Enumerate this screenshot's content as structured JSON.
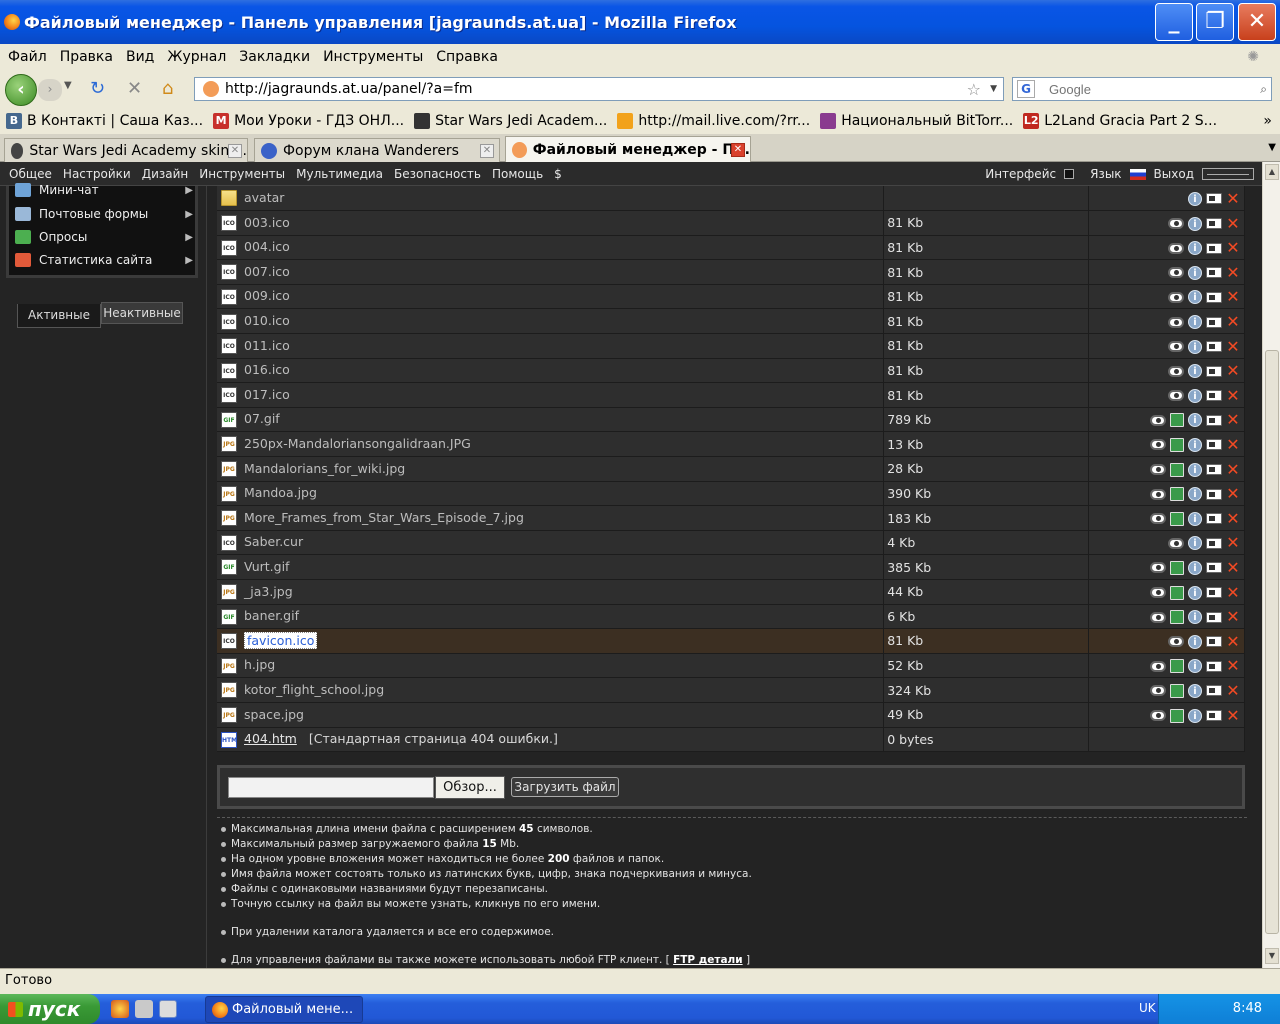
{
  "window": {
    "title": "Файловый менеджер - Панель управления [jagraunds.at.ua] - Mozilla Firefox",
    "min": "_",
    "max": "❐",
    "close": "✕"
  },
  "menu": [
    "Файл",
    "Правка",
    "Вид",
    "Журнал",
    "Закладки",
    "Инструменты",
    "Справка"
  ],
  "nav": {
    "url": "http://jagraunds.at.ua/panel/?a=fm",
    "search_placeholder": "Google"
  },
  "bookmarks": [
    {
      "label": "В Контакті | Саша Каз...",
      "icon": "В",
      "color": "#45688e"
    },
    {
      "label": "Мои Уроки - ГДЗ ОНЛ...",
      "icon": "M",
      "color": "#c7302b"
    },
    {
      "label": "Star Wars Jedi Academ...",
      "icon": "",
      "color": "#333333"
    },
    {
      "label": "http://mail.live.com/?rr...",
      "icon": "",
      "color": "#f2a21b"
    },
    {
      "label": "Национальный BitTorr...",
      "icon": "",
      "color": "#8a3b8f"
    },
    {
      "label": "L2Land Gracia Part 2 S...",
      "icon": "L2",
      "color": "#c0281f"
    }
  ],
  "tabs": [
    {
      "label": "Star Wars Jedi Academy skin ...",
      "color": "#444444"
    },
    {
      "label": "Форум клана Wanderers",
      "color": "#3a62c8"
    },
    {
      "label": "Файловый менеджер - П...",
      "color": "#f39c58"
    }
  ],
  "panel_menu": {
    "items": [
      "Общее",
      "Настройки",
      "Дизайн",
      "Инструменты",
      "Мультимедиа",
      "Безопасность",
      "Помощь",
      "$"
    ],
    "interface": "Интерфейс",
    "language": "Язык",
    "logout": "Выход"
  },
  "sidebar": {
    "items": [
      {
        "label": "Мини-чат",
        "color": "#6fa4d8"
      },
      {
        "label": "Почтовые формы",
        "color": "#9ab8d8"
      },
      {
        "label": "Опросы",
        "color": "#4caf50"
      },
      {
        "label": "Статистика сайта",
        "color": "#e25a3a"
      }
    ],
    "tab_active": "Активные",
    "tab_inactive": "Неактивные"
  },
  "files": [
    {
      "name": "avatar",
      "type": "folder",
      "size": "",
      "actions": [
        "info",
        "rename",
        "delete"
      ]
    },
    {
      "name": "003.ico",
      "type": "ico",
      "size": "81 Kb",
      "actions": [
        "view",
        "info",
        "rename",
        "delete"
      ]
    },
    {
      "name": "004.ico",
      "type": "ico",
      "size": "81 Kb",
      "actions": [
        "view",
        "info",
        "rename",
        "delete"
      ]
    },
    {
      "name": "007.ico",
      "type": "ico",
      "size": "81 Kb",
      "actions": [
        "view",
        "info",
        "rename",
        "delete"
      ]
    },
    {
      "name": "009.ico",
      "type": "ico",
      "size": "81 Kb",
      "actions": [
        "view",
        "info",
        "rename",
        "delete"
      ]
    },
    {
      "name": "010.ico",
      "type": "ico",
      "size": "81 Kb",
      "actions": [
        "view",
        "info",
        "rename",
        "delete"
      ]
    },
    {
      "name": "011.ico",
      "type": "ico",
      "size": "81 Kb",
      "actions": [
        "view",
        "info",
        "rename",
        "delete"
      ]
    },
    {
      "name": "016.ico",
      "type": "ico",
      "size": "81 Kb",
      "actions": [
        "view",
        "info",
        "rename",
        "delete"
      ]
    },
    {
      "name": "017.ico",
      "type": "ico",
      "size": "81 Kb",
      "actions": [
        "view",
        "info",
        "rename",
        "delete"
      ]
    },
    {
      "name": "07.gif",
      "type": "gif",
      "size": "789 Kb",
      "actions": [
        "view",
        "image",
        "info",
        "rename",
        "delete"
      ]
    },
    {
      "name": "250px-Mandaloriansongalidraan.JPG",
      "type": "jpg",
      "size": "13 Kb",
      "actions": [
        "view",
        "image",
        "info",
        "rename",
        "delete"
      ]
    },
    {
      "name": "Mandalorians_for_wiki.jpg",
      "type": "jpg",
      "size": "28 Kb",
      "actions": [
        "view",
        "image",
        "info",
        "rename",
        "delete"
      ]
    },
    {
      "name": "Mandoa.jpg",
      "type": "jpg",
      "size": "390 Kb",
      "actions": [
        "view",
        "image",
        "info",
        "rename",
        "delete"
      ]
    },
    {
      "name": "More_Frames_from_Star_Wars_Episode_7.jpg",
      "type": "jpg",
      "size": "183 Kb",
      "actions": [
        "view",
        "image",
        "info",
        "rename",
        "delete"
      ]
    },
    {
      "name": "Saber.cur",
      "type": "ico",
      "size": "4 Kb",
      "actions": [
        "view",
        "info",
        "rename",
        "delete"
      ]
    },
    {
      "name": "Vurt.gif",
      "type": "gif",
      "size": "385 Kb",
      "actions": [
        "view",
        "image",
        "info",
        "rename",
        "delete"
      ]
    },
    {
      "name": "_ja3.jpg",
      "type": "jpg",
      "size": "44 Kb",
      "actions": [
        "view",
        "image",
        "info",
        "rename",
        "delete"
      ]
    },
    {
      "name": "baner.gif",
      "type": "gif",
      "size": "6 Kb",
      "actions": [
        "view",
        "image",
        "info",
        "rename",
        "delete"
      ]
    },
    {
      "name": "favicon.ico",
      "type": "ico",
      "size": "81 Kb",
      "actions": [
        "view",
        "info",
        "rename",
        "delete"
      ],
      "selected": true
    },
    {
      "name": "h.jpg",
      "type": "jpg",
      "size": "52 Kb",
      "actions": [
        "view",
        "image",
        "info",
        "rename",
        "delete"
      ]
    },
    {
      "name": "kotor_flight_school.jpg",
      "type": "jpg",
      "size": "324 Kb",
      "actions": [
        "view",
        "image",
        "info",
        "rename",
        "delete"
      ]
    },
    {
      "name": "space.jpg",
      "type": "jpg",
      "size": "49 Kb",
      "actions": [
        "view",
        "image",
        "info",
        "rename",
        "delete"
      ]
    },
    {
      "name": "404.htm",
      "type": "htm",
      "size": "0 bytes",
      "actions": [],
      "link": true,
      "desc": "[Стандартная страница 404 ошибки.]"
    }
  ],
  "upload": {
    "browse": "Обзор...",
    "submit": "Загрузить файл"
  },
  "notes": [
    {
      "pre": "Максимальная длина имени файла с расширением ",
      "bold": "45",
      "post": " символов."
    },
    {
      "pre": "Максимальный размер загружаемого файла ",
      "bold": "15",
      "post": " Mb."
    },
    {
      "pre": "На одном уровне вложения может находиться не более ",
      "bold": "200",
      "post": " файлов и папок."
    },
    {
      "pre": "Имя файла может состоять только из латинских букв, цифр, знака подчеркивания и минуса.",
      "bold": "",
      "post": ""
    },
    {
      "pre": "Файлы с одинаковыми названиями будут перезаписаны.",
      "bold": "",
      "post": ""
    },
    {
      "pre": "Точную ссылку на файл вы можете узнать, кликнув по его имени.",
      "bold": "",
      "post": ""
    },
    {
      "pre": "При удалении каталога удаляется и все его содержимое.",
      "bold": "",
      "post": "",
      "gap": true
    },
    {
      "pre": "Для управления файлами вы также можете использовать любой FTP клиент. [ ",
      "link": "FTP детали",
      "post": " ]",
      "gap": true
    }
  ],
  "status": "Готово",
  "taskbar": {
    "start": "пуск",
    "task": "Файловый мене...",
    "lang": "UK",
    "clock": "8:48"
  }
}
